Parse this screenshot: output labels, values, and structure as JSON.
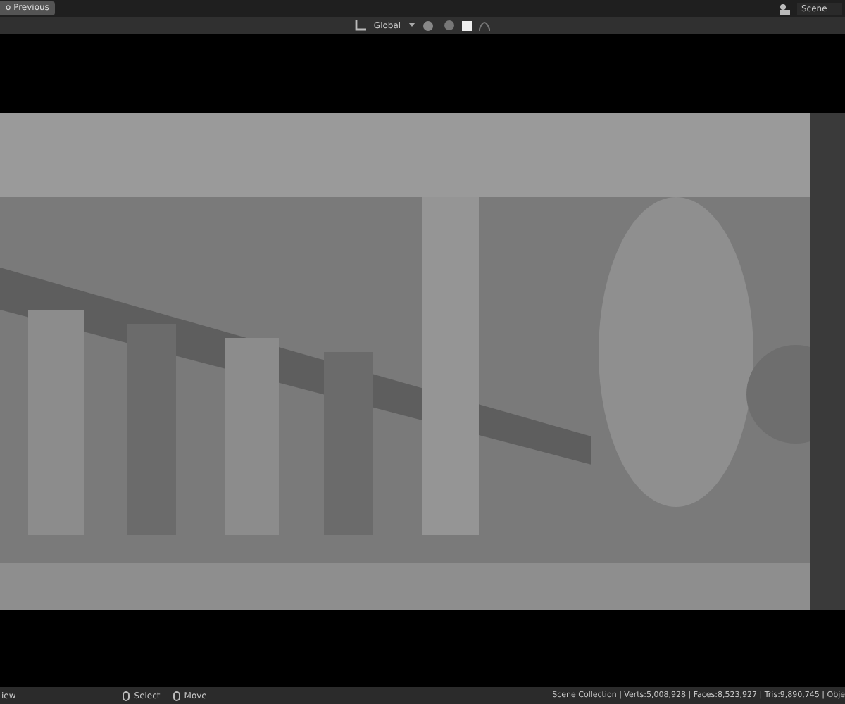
{
  "topbar": {
    "back_button": "o Previous",
    "scene": "Scene"
  },
  "header": {
    "orientation": "Global"
  },
  "status_bar": {
    "left": "iew",
    "hints": [
      {
        "label": "Select"
      },
      {
        "label": "Move"
      }
    ],
    "stats": "Scene Collection | Verts:5,008,928 | Faces:8,523,927 | Tris:9,890,745 | Obje"
  }
}
